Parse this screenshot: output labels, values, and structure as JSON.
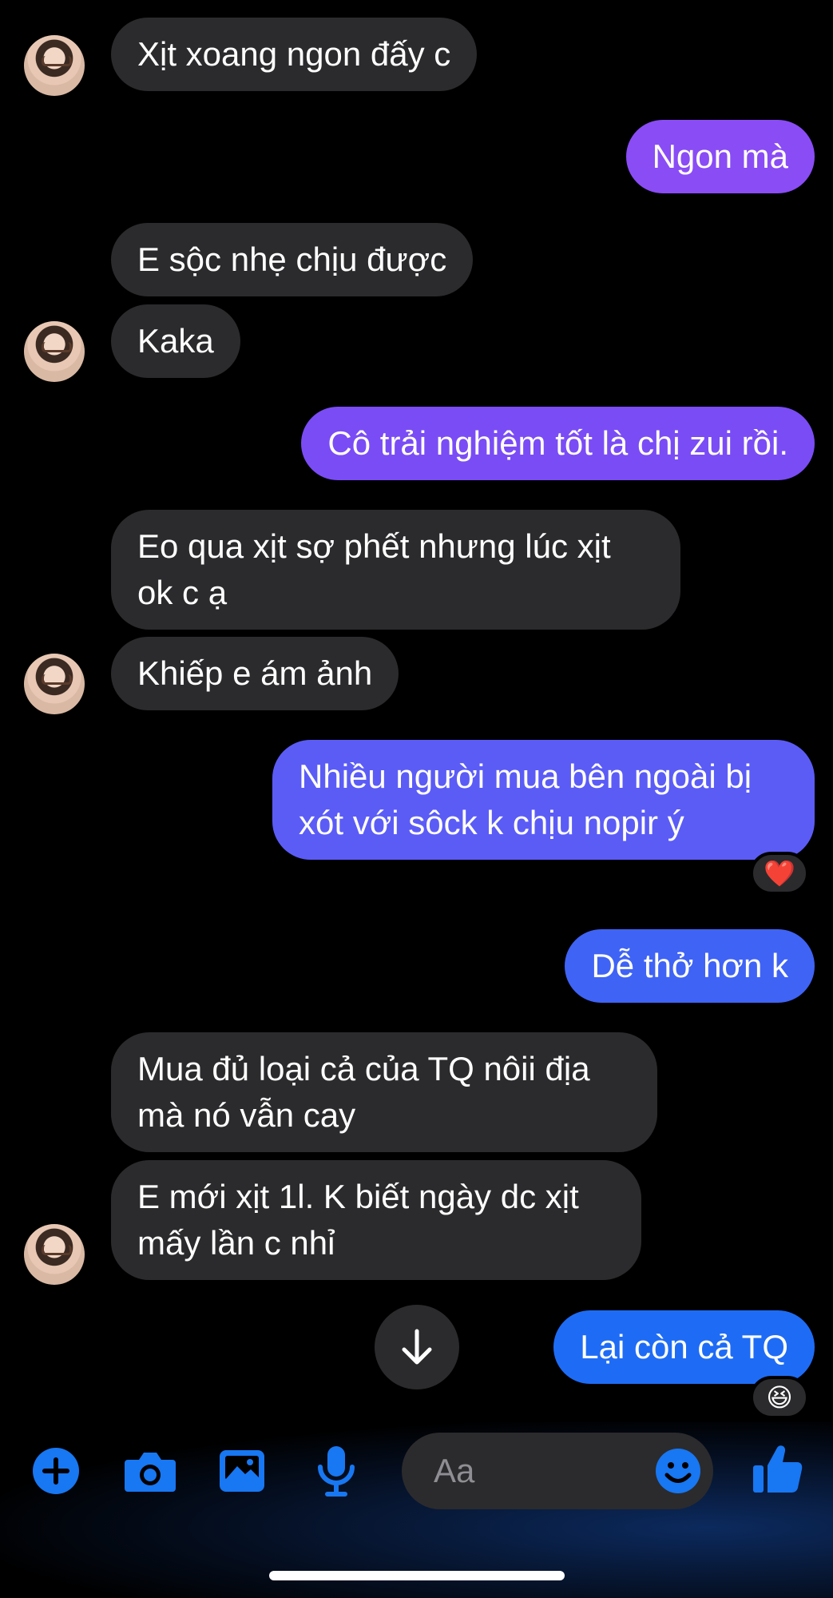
{
  "messages": [
    {
      "side": "in",
      "text": "Xịt xoang ngon đấy c"
    },
    {
      "side": "out",
      "text": "Ngon mà",
      "color": "#8a4cf5"
    },
    {
      "side": "in",
      "text": "E sộc nhẹ chịu được"
    },
    {
      "side": "in",
      "text": "Kaka"
    },
    {
      "side": "out",
      "text": "Cô trải nghiệm tốt là chị zui rồi.",
      "color": "#7a4cf5"
    },
    {
      "side": "in",
      "text": "Eo qua xịt sợ phết nhưng lúc xịt\nok c ạ"
    },
    {
      "side": "in",
      "text": "Khiếp e ám ảnh"
    },
    {
      "side": "out",
      "text": "Nhiều người mua bên ngoài bị\nxót với sôck k chịu nopir ý",
      "color": "#5b5cf6",
      "reaction": "❤️"
    },
    {
      "side": "out",
      "text": "Dễ thở hơn k",
      "color": "#3f63f5"
    },
    {
      "side": "in",
      "text": "Mua đủ loại cả của TQ nôii địa\nmà nó vẫn cay"
    },
    {
      "side": "in",
      "text": "E mới xịt 1l. K biết ngày dc xịt\nmấy lần c nhỉ"
    },
    {
      "side": "out",
      "text": "Lại còn cả TQ",
      "color": "#1e6cf5",
      "reaction": "😆"
    }
  ],
  "composer": {
    "placeholder": "Aa",
    "icons": [
      "plus-icon",
      "camera-icon",
      "image-icon",
      "microphone-icon",
      "emoji-icon",
      "thumbs-up-icon"
    ],
    "accent": "#1877f2"
  }
}
